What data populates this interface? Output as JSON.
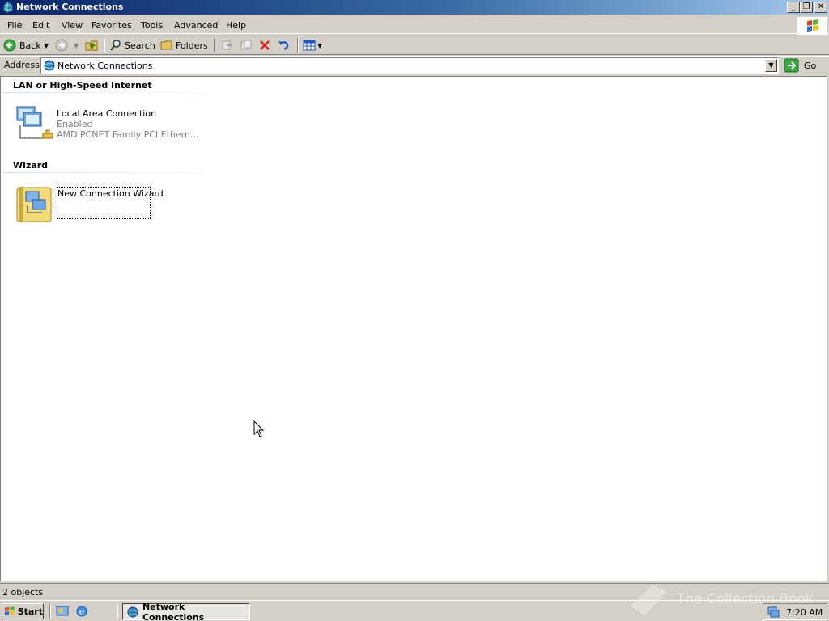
{
  "window": {
    "title": "Network Connections",
    "controls": {
      "minimize": "_",
      "maximize": "❐",
      "close": "✕"
    }
  },
  "menu": [
    "File",
    "Edit",
    "View",
    "Favorites",
    "Tools",
    "Advanced",
    "Help"
  ],
  "toolbar": {
    "back_label": "Back",
    "search_label": "Search",
    "folders_label": "Folders"
  },
  "address": {
    "label": "Address",
    "value": "Network Connections",
    "go_label": "Go"
  },
  "groups": [
    {
      "header": "LAN or High-Speed Internet",
      "items": [
        {
          "name": "Local Area Connection",
          "status": "Enabled",
          "device": "AMD PCNET Family PCI Ethern..."
        }
      ]
    },
    {
      "header": "Wizard",
      "items": [
        {
          "name": "New Connection Wizard"
        }
      ]
    }
  ],
  "statusbar": {
    "text": "2 objects"
  },
  "taskbar": {
    "start_label": "Start",
    "task_label": "Network Connections",
    "clock": "7:20 AM"
  },
  "watermark": "The Collection Book",
  "colors": {
    "title_start": "#0a246a",
    "title_end": "#a6caf0",
    "face": "#d4d0c8"
  }
}
